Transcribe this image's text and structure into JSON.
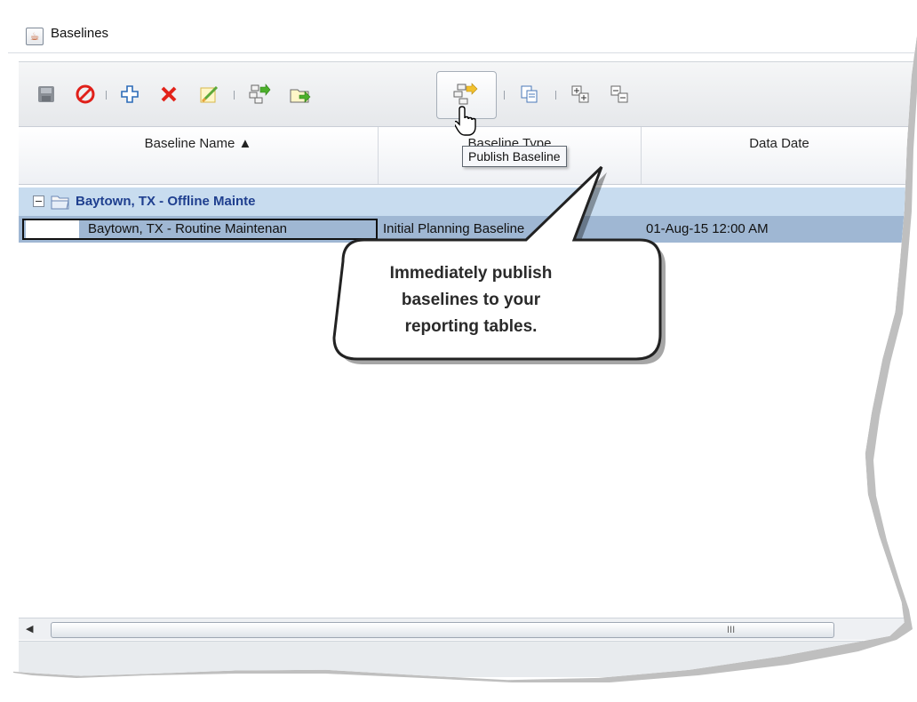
{
  "window": {
    "title": "Baselines"
  },
  "toolbar": {
    "buttons": [
      {
        "name": "save",
        "icon": "save-icon"
      },
      {
        "name": "cancel",
        "icon": "cancel-icon"
      },
      {
        "name": "add",
        "icon": "add-icon"
      },
      {
        "name": "delete",
        "icon": "delete-icon"
      },
      {
        "name": "edit",
        "icon": "edit-icon"
      },
      {
        "name": "assign",
        "icon": "assign-baseline-icon"
      },
      {
        "name": "open",
        "icon": "open-folder-icon"
      },
      {
        "name": "publish",
        "icon": "publish-baseline-icon"
      },
      {
        "name": "copy",
        "icon": "copy-icon"
      },
      {
        "name": "expand",
        "icon": "expand-all-icon"
      },
      {
        "name": "collapse",
        "icon": "collapse-all-icon"
      }
    ],
    "tooltip": "Publish Baseline"
  },
  "grid": {
    "columns": [
      "Baseline Name ▲",
      "Baseline Type",
      "Data Date"
    ],
    "group_row": {
      "name": "Baytown, TX - Offline Mainte"
    },
    "rows": [
      {
        "name": "Baytown, TX - Routine Maintenan",
        "type": "Initial Planning Baseline",
        "date": "01-Aug-15 12:00 AM"
      }
    ]
  },
  "scrollbar": {
    "grip": "III"
  },
  "callout": {
    "line1": "Immediately publish",
    "line2": "baselines to your",
    "line3": "reporting tables."
  },
  "colors": {
    "group_row": "#c8dcef",
    "selected_row": "#9fb7d3",
    "group_text": "#1f3f8f"
  }
}
